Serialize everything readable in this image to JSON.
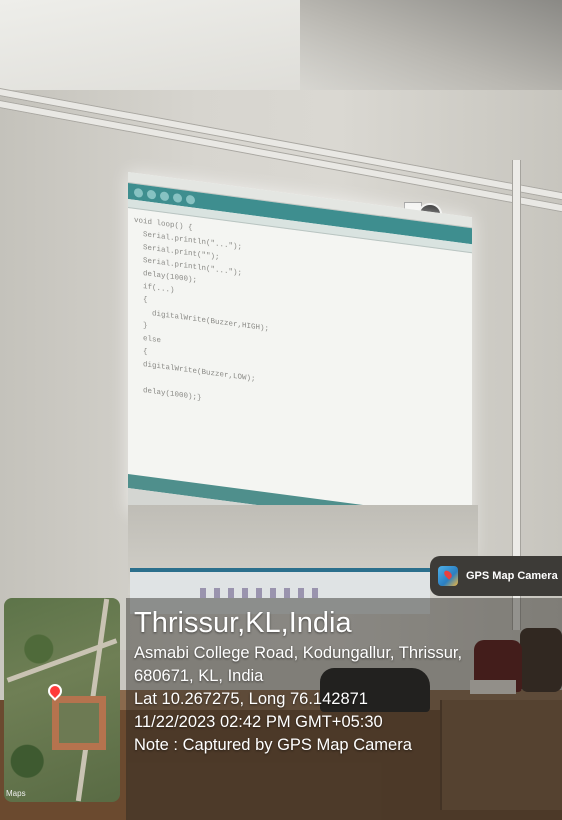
{
  "overlay": {
    "badge": "GPS Map Camera",
    "location_title": "Thrissur,KL,India",
    "address_line1": "Asmabi College Road, Kodungallur, Thrissur,",
    "address_line2": "680671, KL, India",
    "coordinates": "Lat 10.267275, Long 76.142871",
    "datetime": "11/22/2023 02:42 PM GMT+05:30",
    "note": "Note : Captured by GPS Map Camera",
    "map_label": "Maps"
  },
  "projection": {
    "code_lines": [
      "void loop() {",
      "  Serial.println(\"...\");",
      "  Serial.print(\"\");",
      "  Serial.println(\"...\");",
      "  delay(1000);",
      "  if(...)",
      "  {",
      "    digitalWrite(Buzzer,HIGH);",
      "  }",
      "  else",
      "  {",
      "  digitalWrite(Buzzer,LOW);",
      "",
      "  delay(1000);}"
    ]
  }
}
